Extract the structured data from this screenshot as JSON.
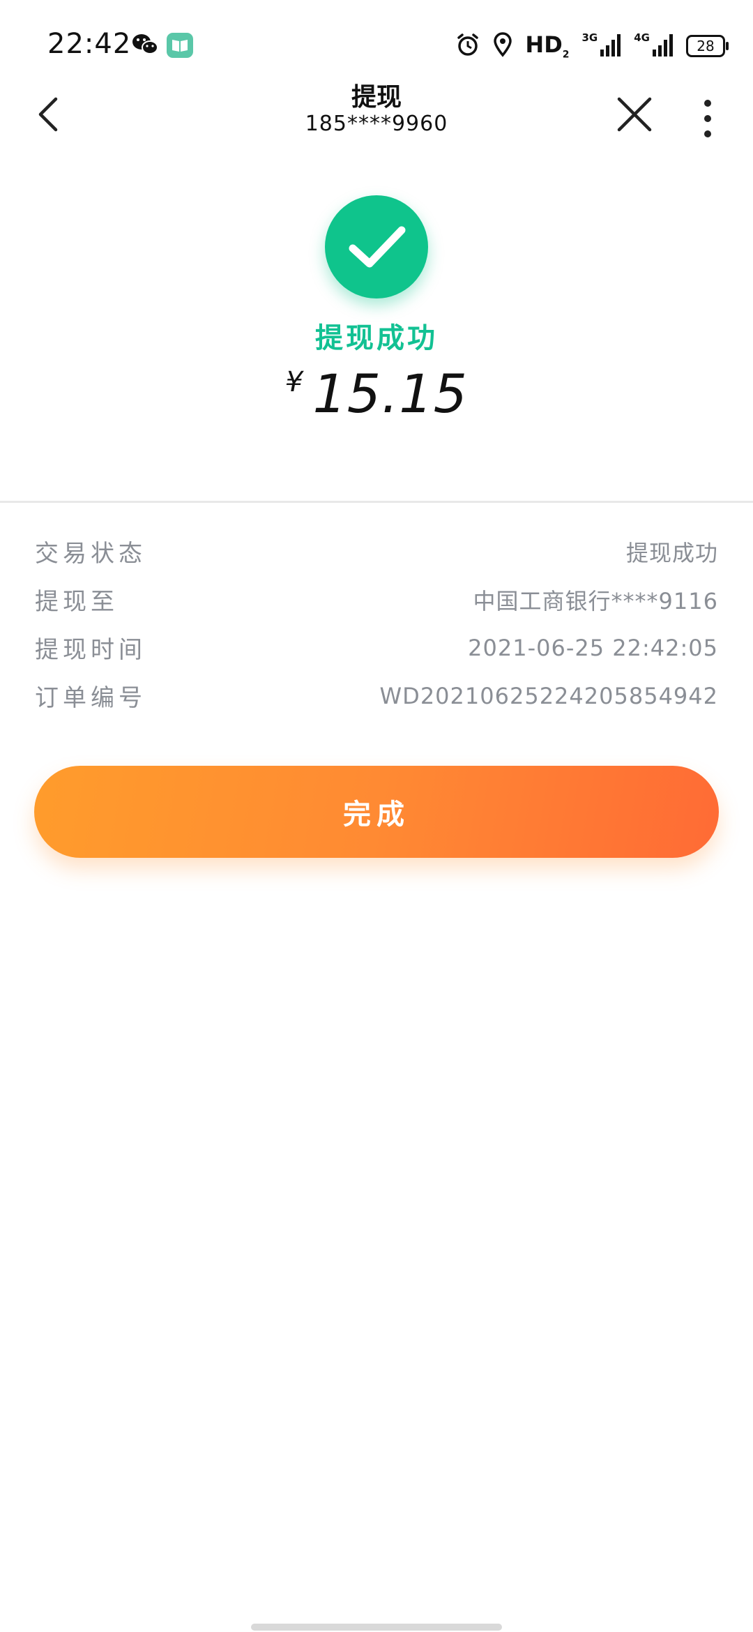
{
  "status_bar": {
    "time": "22:42",
    "hd_label": "HD",
    "hd_sub": "2",
    "net_3g": "3G",
    "net_4g": "4G",
    "battery": "28"
  },
  "nav": {
    "title": "提现",
    "subtitle": "185****9960"
  },
  "result": {
    "status": "提现成功",
    "currency": "¥",
    "amount": "15.15"
  },
  "details": [
    {
      "label": "交易状态",
      "value": "提现成功"
    },
    {
      "label": "提现至",
      "value": "中国工商银行****9116"
    },
    {
      "label": "提现时间",
      "value": "2021-06-25 22:42:05"
    },
    {
      "label": "订单编号",
      "value": "WD20210625224205854942"
    }
  ],
  "actions": {
    "done_label": "完成"
  },
  "colors": {
    "success_green": "#0fc48c",
    "button_orange_start": "#ff9c2c",
    "button_orange_end": "#ff6b35",
    "detail_gray": "#8a8e95"
  }
}
